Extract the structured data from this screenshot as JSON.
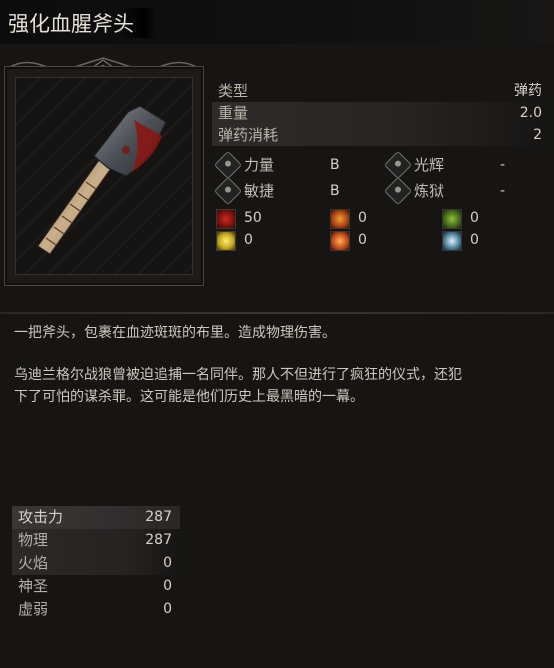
{
  "weapon": {
    "name": "强化血腥斧头"
  },
  "stats": [
    {
      "label": "类型",
      "value": "弹药",
      "shaded": false
    },
    {
      "label": "重量",
      "value": "2.0",
      "shaded": true
    },
    {
      "label": "弹药消耗",
      "value": "2",
      "shaded": true
    }
  ],
  "scaling": {
    "left": [
      {
        "label": "力量",
        "grade": "B",
        "icon": "strength-icon"
      },
      {
        "label": "敏捷",
        "grade": "B",
        "icon": "dexterity-icon"
      }
    ],
    "right": [
      {
        "label": "光辉",
        "grade": "-",
        "icon": "radiance-icon"
      },
      {
        "label": "炼狱",
        "grade": "-",
        "icon": "inferno-icon"
      }
    ]
  },
  "effects": [
    {
      "icon": "bleed-icon",
      "value": "50",
      "color": "#8e1a14"
    },
    {
      "icon": "burn-icon",
      "value": "0",
      "color": "#c45a12"
    },
    {
      "icon": "poison-icon",
      "value": "0",
      "color": "#4f7a1e"
    },
    {
      "icon": "shock-icon",
      "value": "0",
      "color": "#c8a820"
    },
    {
      "icon": "blast-icon",
      "value": "0",
      "color": "#c0481a"
    },
    {
      "icon": "frost-icon",
      "value": "0",
      "color": "#4a7d94"
    }
  ],
  "description": {
    "line1": "一把斧头，包裹在血迹斑斑的布里。造成物理伤害。",
    "line2": "乌迪兰格尔战狼曾被迫追捕一名同伴。那人不但进行了疯狂的仪式，还犯\n下了可怕的谋杀罪。这可能是他们历史上最黑暗的一幕。"
  },
  "attack": [
    {
      "label": "攻击力",
      "value": "287",
      "style": "head"
    },
    {
      "label": "物理",
      "value": "287",
      "style": "shade"
    },
    {
      "label": "火焰",
      "value": "0",
      "style": "shade"
    },
    {
      "label": "神圣",
      "value": "0",
      "style": "plain"
    },
    {
      "label": "虚弱",
      "value": "0",
      "style": "plain"
    }
  ]
}
